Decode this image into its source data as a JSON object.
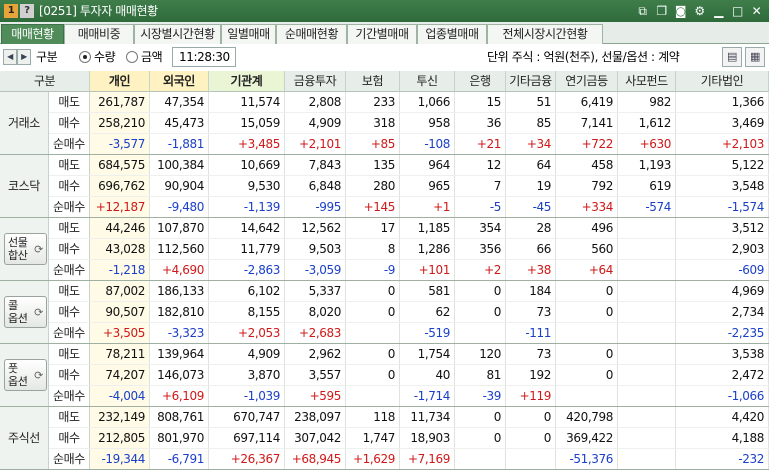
{
  "window": {
    "title": "[0251] 투자자 매매현황",
    "icon1": "1",
    "icon2": "?"
  },
  "titlebar_icons": [
    "link-icon",
    "copy-icon",
    "camera-icon",
    "gear-icon",
    "minimize-icon",
    "maximize-icon",
    "close-icon"
  ],
  "tabs": [
    "매매현황",
    "매매비중",
    "시장별시간현황",
    "일별매매",
    "순매매현황",
    "기간별매매",
    "업종별매매",
    "전체시장시간현황"
  ],
  "active_tab": 0,
  "toolbar": {
    "label": "구분",
    "radio1": "수량",
    "radio2": "금액",
    "selected": "수량",
    "time": "11:28:30",
    "unit_text": "단위 주식 : 억원(천주), 선물/옵션 : 계약"
  },
  "columns": [
    "구분",
    "개인",
    "외국인",
    "기관계",
    "금융투자",
    "보험",
    "투신",
    "은행",
    "기타금융",
    "연기금등",
    "사모펀드",
    "기타법인"
  ],
  "row_labels": [
    "매도",
    "매수",
    "순매수"
  ],
  "groups": [
    {
      "name": "거래소",
      "button": false,
      "rows": [
        [
          "261,787",
          "47,354",
          "11,574",
          "2,808",
          "233",
          "1,066",
          "15",
          "51",
          "6,419",
          "982",
          "1,366"
        ],
        [
          "258,210",
          "45,473",
          "15,059",
          "4,909",
          "318",
          "958",
          "36",
          "85",
          "7,141",
          "1,612",
          "3,469"
        ],
        [
          "-3,577",
          "-1,881",
          "+3,485",
          "+2,101",
          "+85",
          "-108",
          "+21",
          "+34",
          "+722",
          "+630",
          "+2,103"
        ]
      ]
    },
    {
      "name": "코스닥",
      "button": false,
      "rows": [
        [
          "684,575",
          "100,384",
          "10,669",
          "7,843",
          "135",
          "964",
          "12",
          "64",
          "458",
          "1,193",
          "5,122"
        ],
        [
          "696,762",
          "90,904",
          "9,530",
          "6,848",
          "280",
          "965",
          "7",
          "19",
          "792",
          "619",
          "3,548"
        ],
        [
          "+12,187",
          "-9,480",
          "-1,139",
          "-995",
          "+145",
          "+1",
          "-5",
          "-45",
          "+334",
          "-574",
          "-1,574"
        ]
      ]
    },
    {
      "name": "선물합산",
      "line1": "선물",
      "line2": "합산",
      "button": true,
      "rows": [
        [
          "44,246",
          "107,870",
          "14,642",
          "12,562",
          "17",
          "1,185",
          "354",
          "28",
          "496",
          "",
          "3,512"
        ],
        [
          "43,028",
          "112,560",
          "11,779",
          "9,503",
          "8",
          "1,286",
          "356",
          "66",
          "560",
          "",
          "2,903"
        ],
        [
          "-1,218",
          "+4,690",
          "-2,863",
          "-3,059",
          "-9",
          "+101",
          "+2",
          "+38",
          "+64",
          "",
          "-609"
        ]
      ]
    },
    {
      "name": "콜옵션",
      "line1": "콜",
      "line2": "옵션",
      "button": true,
      "rows": [
        [
          "87,002",
          "186,133",
          "6,102",
          "5,337",
          "0",
          "581",
          "0",
          "184",
          "0",
          "",
          "4,969"
        ],
        [
          "90,507",
          "182,810",
          "8,155",
          "8,020",
          "0",
          "62",
          "0",
          "73",
          "0",
          "",
          "2,734"
        ],
        [
          "+3,505",
          "-3,323",
          "+2,053",
          "+2,683",
          "",
          "-519",
          "",
          "-111",
          "",
          "",
          "-2,235"
        ]
      ]
    },
    {
      "name": "풋옵션",
      "line1": "풋",
      "line2": "옵션",
      "button": true,
      "rows": [
        [
          "78,211",
          "139,964",
          "4,909",
          "2,962",
          "0",
          "1,754",
          "120",
          "73",
          "0",
          "",
          "3,538"
        ],
        [
          "74,207",
          "146,073",
          "3,870",
          "3,557",
          "0",
          "40",
          "81",
          "192",
          "0",
          "",
          "2,472"
        ],
        [
          "-4,004",
          "+6,109",
          "-1,039",
          "+595",
          "",
          "-1,714",
          "-39",
          "+119",
          "",
          "",
          "-1,066"
        ]
      ]
    },
    {
      "name": "주식선",
      "button": false,
      "rows": [
        [
          "232,149",
          "808,761",
          "670,747",
          "238,097",
          "118",
          "11,734",
          "0",
          "0",
          "420,798",
          "",
          "4,420"
        ],
        [
          "212,805",
          "801,970",
          "697,114",
          "307,042",
          "1,747",
          "18,903",
          "0",
          "0",
          "369,422",
          "",
          "4,188"
        ],
        [
          "-19,344",
          "-6,791",
          "+26,367",
          "+68,945",
          "+1,629",
          "+7,169",
          "",
          "",
          "-51,376",
          "",
          "-232"
        ]
      ]
    }
  ],
  "colors": {
    "positive": "#d01818",
    "negative": "#1a3fc8",
    "tab_active": "#4f8c5a",
    "titlebar": "#2f6a3b"
  }
}
